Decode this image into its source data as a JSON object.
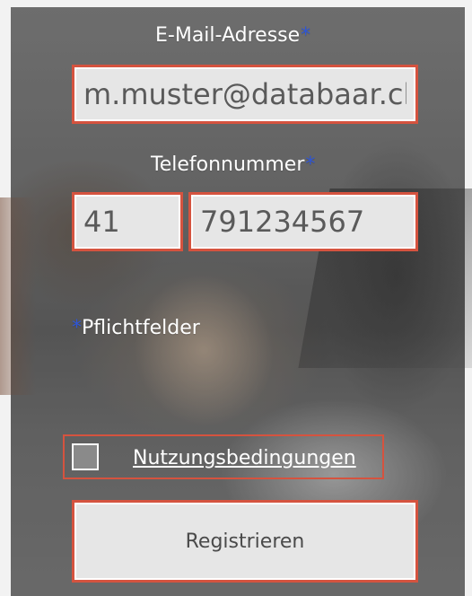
{
  "form": {
    "email_label": "E-Mail-Adresse",
    "required_marker": "*",
    "email_value": "m.muster@databaar.ch",
    "phone_label": "Telefonnummer",
    "phone_country_code": "41",
    "phone_number": "791234567",
    "required_note": "Pflichtfelder",
    "terms_link": "Nutzungsbedingungen",
    "register_button": "Registrieren"
  },
  "colors": {
    "accent_border": "#d5533f",
    "required_marker": "#2f56d6",
    "input_fill": "#e6e6e6"
  }
}
